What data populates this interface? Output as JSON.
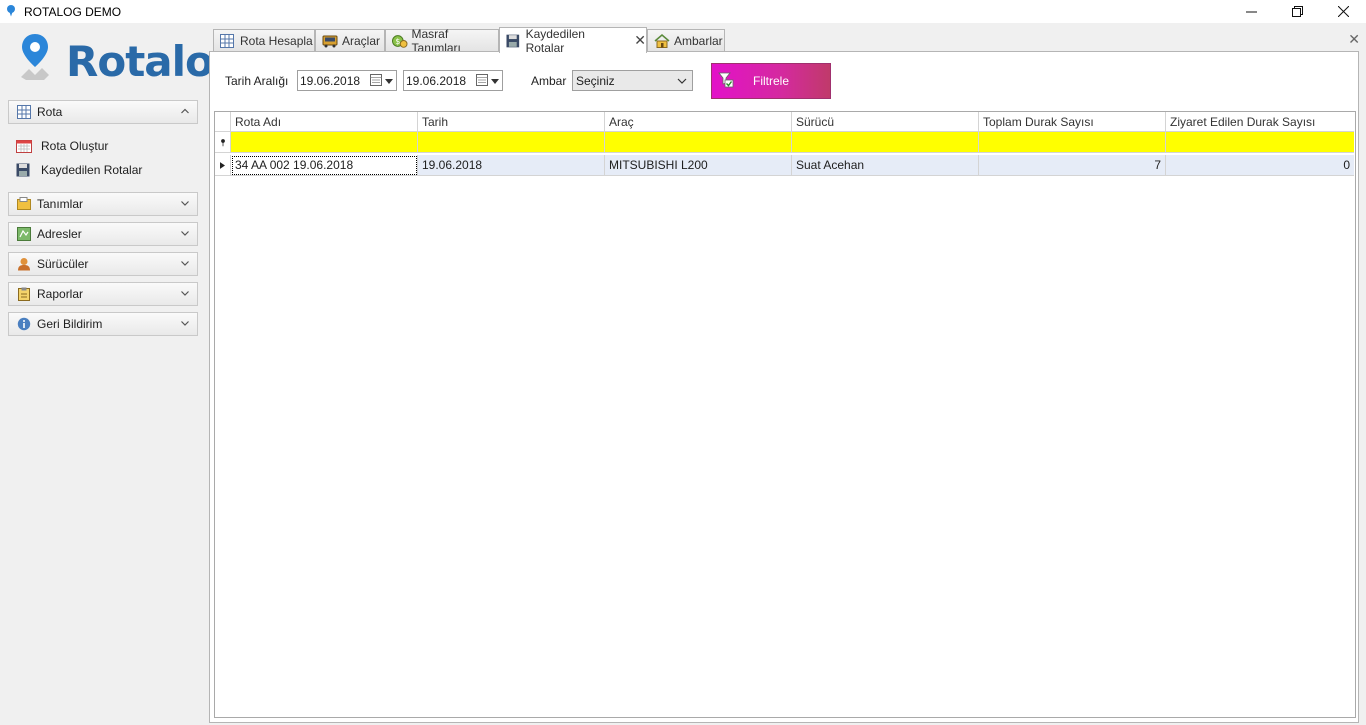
{
  "window": {
    "title": "ROTALOG DEMO"
  },
  "brand": {
    "logo_text": "Rotalog",
    "color": "#2a6aa8"
  },
  "sidebar": {
    "groups": [
      {
        "label": "Rota",
        "icon": "route-grid-icon",
        "expanded": true
      },
      {
        "label": "Tanımlar",
        "icon": "folder-icon",
        "expanded": false
      },
      {
        "label": "Adresler",
        "icon": "map-icon",
        "expanded": false
      },
      {
        "label": "Sürücüler",
        "icon": "driver-icon",
        "expanded": false
      },
      {
        "label": "Raporlar",
        "icon": "clipboard-icon",
        "expanded": false
      },
      {
        "label": "Geri Bildirim",
        "icon": "info-icon",
        "expanded": false
      }
    ],
    "rota_items": [
      {
        "label": "Rota Oluştur",
        "icon": "calendar-icon"
      },
      {
        "label": "Kaydedilen Rotalar",
        "icon": "save-icon"
      }
    ]
  },
  "tabs": [
    {
      "label": "Rota Hesapla",
      "icon": "route-grid-icon"
    },
    {
      "label": "Araçlar",
      "icon": "truck-icon"
    },
    {
      "label": "Masraf Tanımları",
      "icon": "money-icon"
    },
    {
      "label": "Kaydedilen Rotalar",
      "icon": "save-icon",
      "active": true
    },
    {
      "label": "Ambarlar",
      "icon": "home-icon"
    }
  ],
  "filters": {
    "date_range_label": "Tarih Aralığı",
    "date_from": "19.06.2018",
    "date_to": "19.06.2018",
    "warehouse_label": "Ambar",
    "warehouse_value": "Seçiniz",
    "filter_button": "Filtrele",
    "filter_button_color": "#e311c9"
  },
  "grid": {
    "columns": [
      "Rota Adı",
      "Tarih",
      "Araç",
      "Sürücü",
      "Toplam Durak Sayısı",
      "Ziyaret Edilen Durak Sayısı"
    ],
    "autofilter_color": "#ffff00",
    "rows": [
      {
        "rota_adi": "34 AA 002 19.06.2018",
        "tarih": "19.06.2018",
        "arac": "MITSUBISHI L200",
        "surucu": "Suat Acehan",
        "toplam": "7",
        "ziyaret": "0"
      }
    ]
  }
}
